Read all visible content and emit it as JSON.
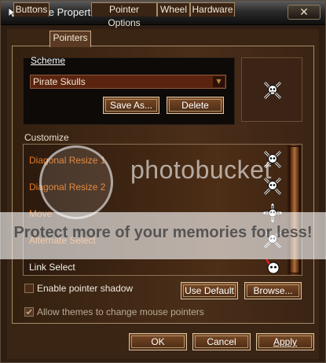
{
  "window": {
    "title": "Mouse Properties",
    "close_label": "✕"
  },
  "tabs": [
    {
      "label": "Buttons"
    },
    {
      "label": "Pointers",
      "active": true
    },
    {
      "label": "Pointer Options"
    },
    {
      "label": "Wheel"
    },
    {
      "label": "Hardware"
    }
  ],
  "scheme": {
    "label": "Scheme",
    "selected": "Pirate Skulls",
    "save_as_label": "Save As...",
    "delete_label": "Delete"
  },
  "customize": {
    "label": "Customize",
    "items": [
      {
        "label": "Diagonal Resize 1",
        "icon": "skull-crossbones-cursor-icon"
      },
      {
        "label": "Diagonal Resize 2",
        "icon": "skull-crossbones-cursor-icon"
      },
      {
        "label": "Move",
        "icon": "skull-move-cursor-icon"
      },
      {
        "label": "Alternate Select",
        "icon": "skull-crossbones-cursor-icon"
      },
      {
        "label": "Link Select",
        "icon": "pointing-hand-skull-cursor-icon"
      }
    ]
  },
  "options": {
    "enable_shadow_label": "Enable pointer shadow",
    "enable_shadow_checked": false,
    "allow_themes_label": "Allow themes to change mouse pointers",
    "allow_themes_checked": true,
    "use_default_label": "Use Default",
    "browse_label": "Browse..."
  },
  "footer": {
    "ok_label": "OK",
    "cancel_label": "Cancel",
    "apply_label": "Apply"
  },
  "watermark": {
    "brand": "photobucket",
    "tagline": "Protect more of your memories for less!"
  },
  "colors": {
    "accent_orange": "#e27a26",
    "panel_brown": "#4a2e19"
  }
}
